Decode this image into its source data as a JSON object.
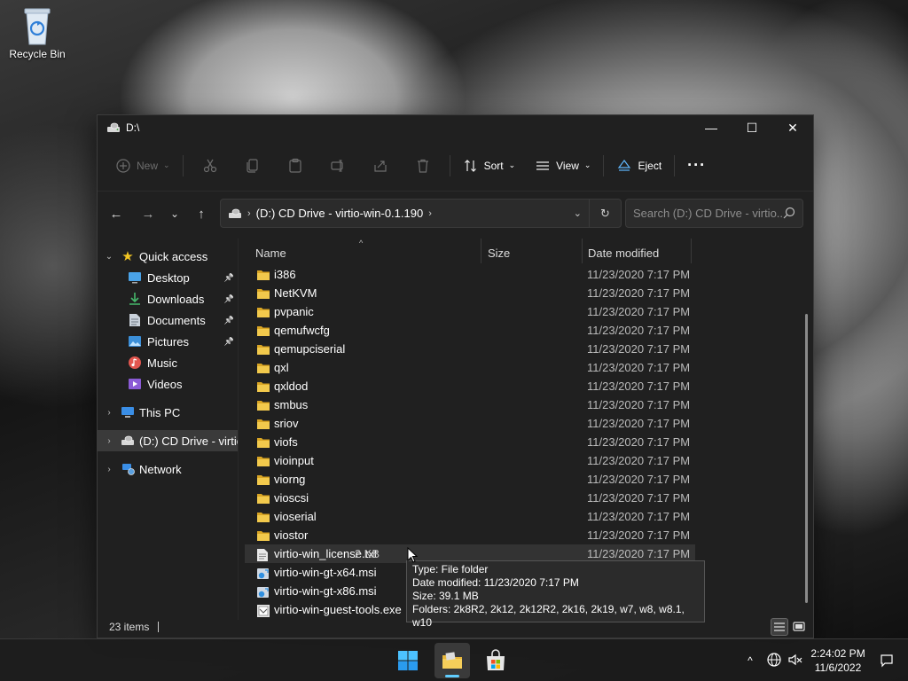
{
  "desktop": {
    "icons": [
      {
        "label": "Recycle Bin",
        "icon": "recycle-bin-icon"
      }
    ]
  },
  "window": {
    "title": "D:\\",
    "controls": {
      "minimize": "—",
      "maximize": "☐",
      "close": "✕"
    }
  },
  "command_bar": {
    "new_label": "New",
    "sort_label": "Sort",
    "view_label": "View",
    "eject_label": "Eject",
    "more_label": "···",
    "disabled_actions": [
      "cut-icon",
      "copy-icon",
      "paste-icon",
      "rename-icon",
      "share-icon",
      "delete-icon"
    ]
  },
  "address_bar": {
    "segments": [
      "(D:) CD Drive - virtio-win-0.1.190"
    ],
    "search_placeholder": "Search (D:) CD Drive - virtio..."
  },
  "nav_pane": {
    "quick_access": "Quick access",
    "items": [
      {
        "label": "Desktop",
        "icon": "desktop-icon",
        "pinned": true
      },
      {
        "label": "Downloads",
        "icon": "downloads-icon",
        "pinned": true
      },
      {
        "label": "Documents",
        "icon": "documents-icon",
        "pinned": true
      },
      {
        "label": "Pictures",
        "icon": "pictures-icon",
        "pinned": true
      },
      {
        "label": "Music",
        "icon": "music-icon",
        "pinned": false
      },
      {
        "label": "Videos",
        "icon": "videos-icon",
        "pinned": false
      }
    ],
    "this_pc": "This PC",
    "cd_drive": "(D:) CD Drive - virtio-win-0.1.190",
    "network": "Network"
  },
  "columns": {
    "name": "Name",
    "size": "Size",
    "date_modified": "Date modified"
  },
  "files": [
    {
      "name": "i386",
      "type": "folder",
      "size": "",
      "date": "11/23/2020 7:17 PM"
    },
    {
      "name": "NetKVM",
      "type": "folder",
      "size": "",
      "date": "11/23/2020 7:17 PM"
    },
    {
      "name": "pvpanic",
      "type": "folder",
      "size": "",
      "date": "11/23/2020 7:17 PM"
    },
    {
      "name": "qemufwcfg",
      "type": "folder",
      "size": "",
      "date": "11/23/2020 7:17 PM"
    },
    {
      "name": "qemupciserial",
      "type": "folder",
      "size": "",
      "date": "11/23/2020 7:17 PM"
    },
    {
      "name": "qxl",
      "type": "folder",
      "size": "",
      "date": "11/23/2020 7:17 PM"
    },
    {
      "name": "qxldod",
      "type": "folder",
      "size": "",
      "date": "11/23/2020 7:17 PM"
    },
    {
      "name": "smbus",
      "type": "folder",
      "size": "",
      "date": "11/23/2020 7:17 PM"
    },
    {
      "name": "sriov",
      "type": "folder",
      "size": "",
      "date": "11/23/2020 7:17 PM"
    },
    {
      "name": "viofs",
      "type": "folder",
      "size": "",
      "date": "11/23/2020 7:17 PM"
    },
    {
      "name": "vioinput",
      "type": "folder",
      "size": "",
      "date": "11/23/2020 7:17 PM"
    },
    {
      "name": "viorng",
      "type": "folder",
      "size": "",
      "date": "11/23/2020 7:17 PM"
    },
    {
      "name": "vioscsi",
      "type": "folder",
      "size": "",
      "date": "11/23/2020 7:17 PM"
    },
    {
      "name": "vioserial",
      "type": "folder",
      "size": "",
      "date": "11/23/2020 7:17 PM"
    },
    {
      "name": "viostor",
      "type": "folder",
      "size": "",
      "date": "11/23/2020 7:17 PM"
    },
    {
      "name": "virtio-win_license.txt",
      "type": "text",
      "size": "2 KB",
      "date": "11/23/2020 7:17 PM"
    },
    {
      "name": "virtio-win-gt-x64.msi",
      "type": "msi",
      "size": "",
      "date": ""
    },
    {
      "name": "virtio-win-gt-x86.msi",
      "type": "msi",
      "size": "",
      "date": ""
    },
    {
      "name": "virtio-win-guest-tools.exe",
      "type": "exe",
      "size": "",
      "date": ""
    }
  ],
  "tooltip": {
    "type_line": "Type: File folder",
    "date_line": "Date modified: 11/23/2020 7:17 PM",
    "size_line": "Size: 39.1 MB",
    "folders_line": "Folders: 2k8R2, 2k12, 2k12R2, 2k16, 2k19, w7, w8, w8.1, w10"
  },
  "status_bar": {
    "item_count": "23 items"
  },
  "taskbar": {
    "apps": [
      "start-icon",
      "file-explorer-icon",
      "microsoft-store-icon"
    ],
    "time": "2:24:02 PM",
    "date": "11/6/2022"
  },
  "colors": {
    "accent": "#60cdff",
    "folder": "#e8b73a",
    "window_bg": "#202020"
  }
}
